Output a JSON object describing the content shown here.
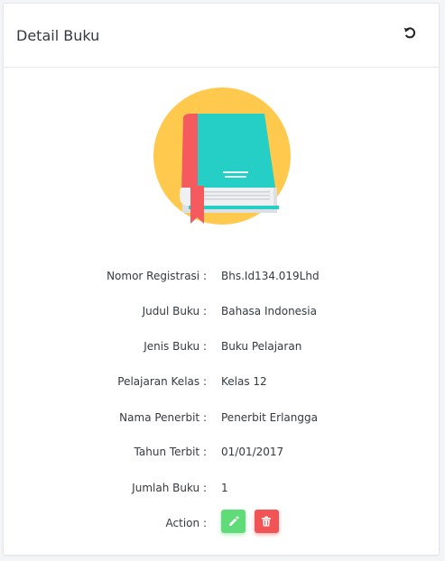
{
  "header": {
    "title": "Detail Buku",
    "refresh_icon": "refresh-icon"
  },
  "illustration": {
    "icon": "book-icon",
    "colors": {
      "circle": "#ffc94d",
      "cover": "#25cfc6",
      "spine": "#f55b5e",
      "pages": "#eef0f2",
      "bookmark": "#f55b5e"
    }
  },
  "details": {
    "nomor_registrasi": {
      "label": "Nomor Registrasi :",
      "value": "Bhs.Id134.019Lhd"
    },
    "judul_buku": {
      "label": "Judul Buku :",
      "value": "Bahasa Indonesia"
    },
    "jenis_buku": {
      "label": "Jenis Buku :",
      "value": "Buku Pelajaran"
    },
    "pelajaran_kelas": {
      "label": "Pelajaran Kelas :",
      "value": "Kelas 12"
    },
    "nama_penerbit": {
      "label": "Nama Penerbit :",
      "value": "Penerbit Erlangga"
    },
    "tahun_terbit": {
      "label": "Tahun Terbit :",
      "value": "01/01/2017"
    },
    "jumlah_buku": {
      "label": "Jumlah Buku :",
      "value": "1"
    },
    "action": {
      "label": "Action :"
    }
  },
  "actions": {
    "edit_icon": "pencil-icon",
    "edit_color": "#5fdc78",
    "delete_icon": "trash-icon",
    "delete_color": "#f05455"
  }
}
